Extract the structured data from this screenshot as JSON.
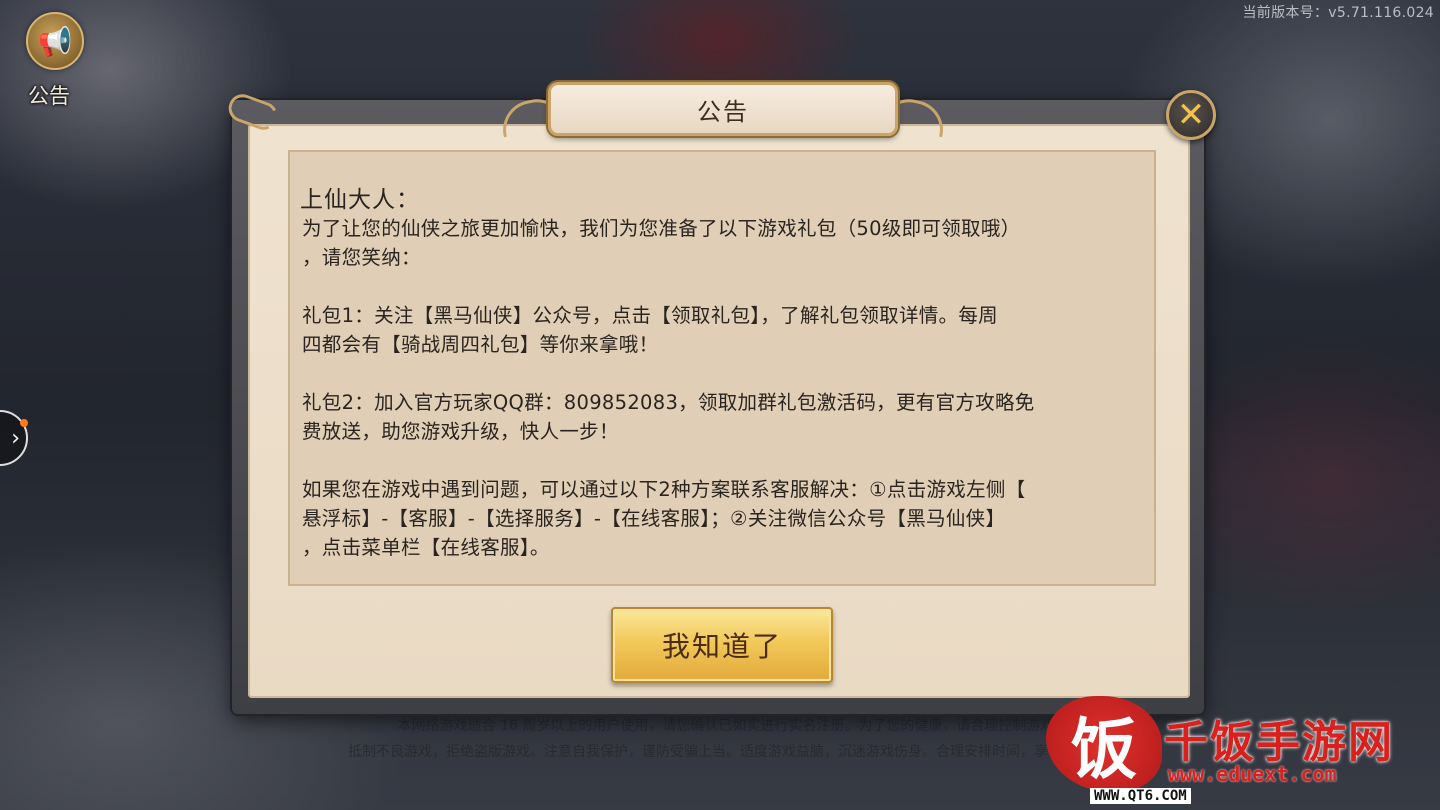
{
  "app": {
    "version_text": "当前版本号：v5.71.116.024",
    "notice_button_label": "公告",
    "side_toggle_glyph": "›"
  },
  "background_notice": {
    "line1": "本网络游戏适合 16 周岁以上的用户使用，请您确认已如实进行实名注册。为了您的健康，请合理控制游戏时间",
    "line2": "抵制不良游戏，拒绝盗版游戏。注意自我保护，谨防受骗上当。适度游戏益脑，沉迷游戏伤身。合理安排时间，享受健康生活。"
  },
  "dialog": {
    "title": "公告",
    "close_glyph": "✕",
    "greeting": "上仙大人：",
    "body": " 为了让您的仙侠之旅更加愉快，我们为您准备了以下游戏礼包（50级即可领取哦）\n，请您笑纳：\n\n 礼包1：关注【黑马仙侠】公众号，点击【领取礼包】，了解礼包领取详情。每周\n四都会有【骑战周四礼包】等你来拿哦！\n\n 礼包2：加入官方玩家QQ群：809852083，领取加群礼包激活码，更有官方攻略免\n费放送，助您游戏升级，快人一步！\n\n如果您在游戏中遇到问题，可以通过以下2种方案联系客服解决：①点击游戏左侧【\n悬浮标】-【客服】-【选择服务】-【在线客服】；②关注微信公众号【黑马仙侠】\n，点击菜单栏【在线客服】。",
    "confirm_label": "我知道了"
  },
  "watermark": {
    "logo_char": "饭",
    "title": "千饭手游网",
    "url": "www.eduext.com",
    "site": "WWW.QT6.COM"
  },
  "colors": {
    "dialog_bg": "#efe2cf",
    "content_bg": "#e0cfb6",
    "gold_border": "#c9a56a",
    "confirm_button": "#f2c95a",
    "watermark_red": "#d9201d"
  }
}
